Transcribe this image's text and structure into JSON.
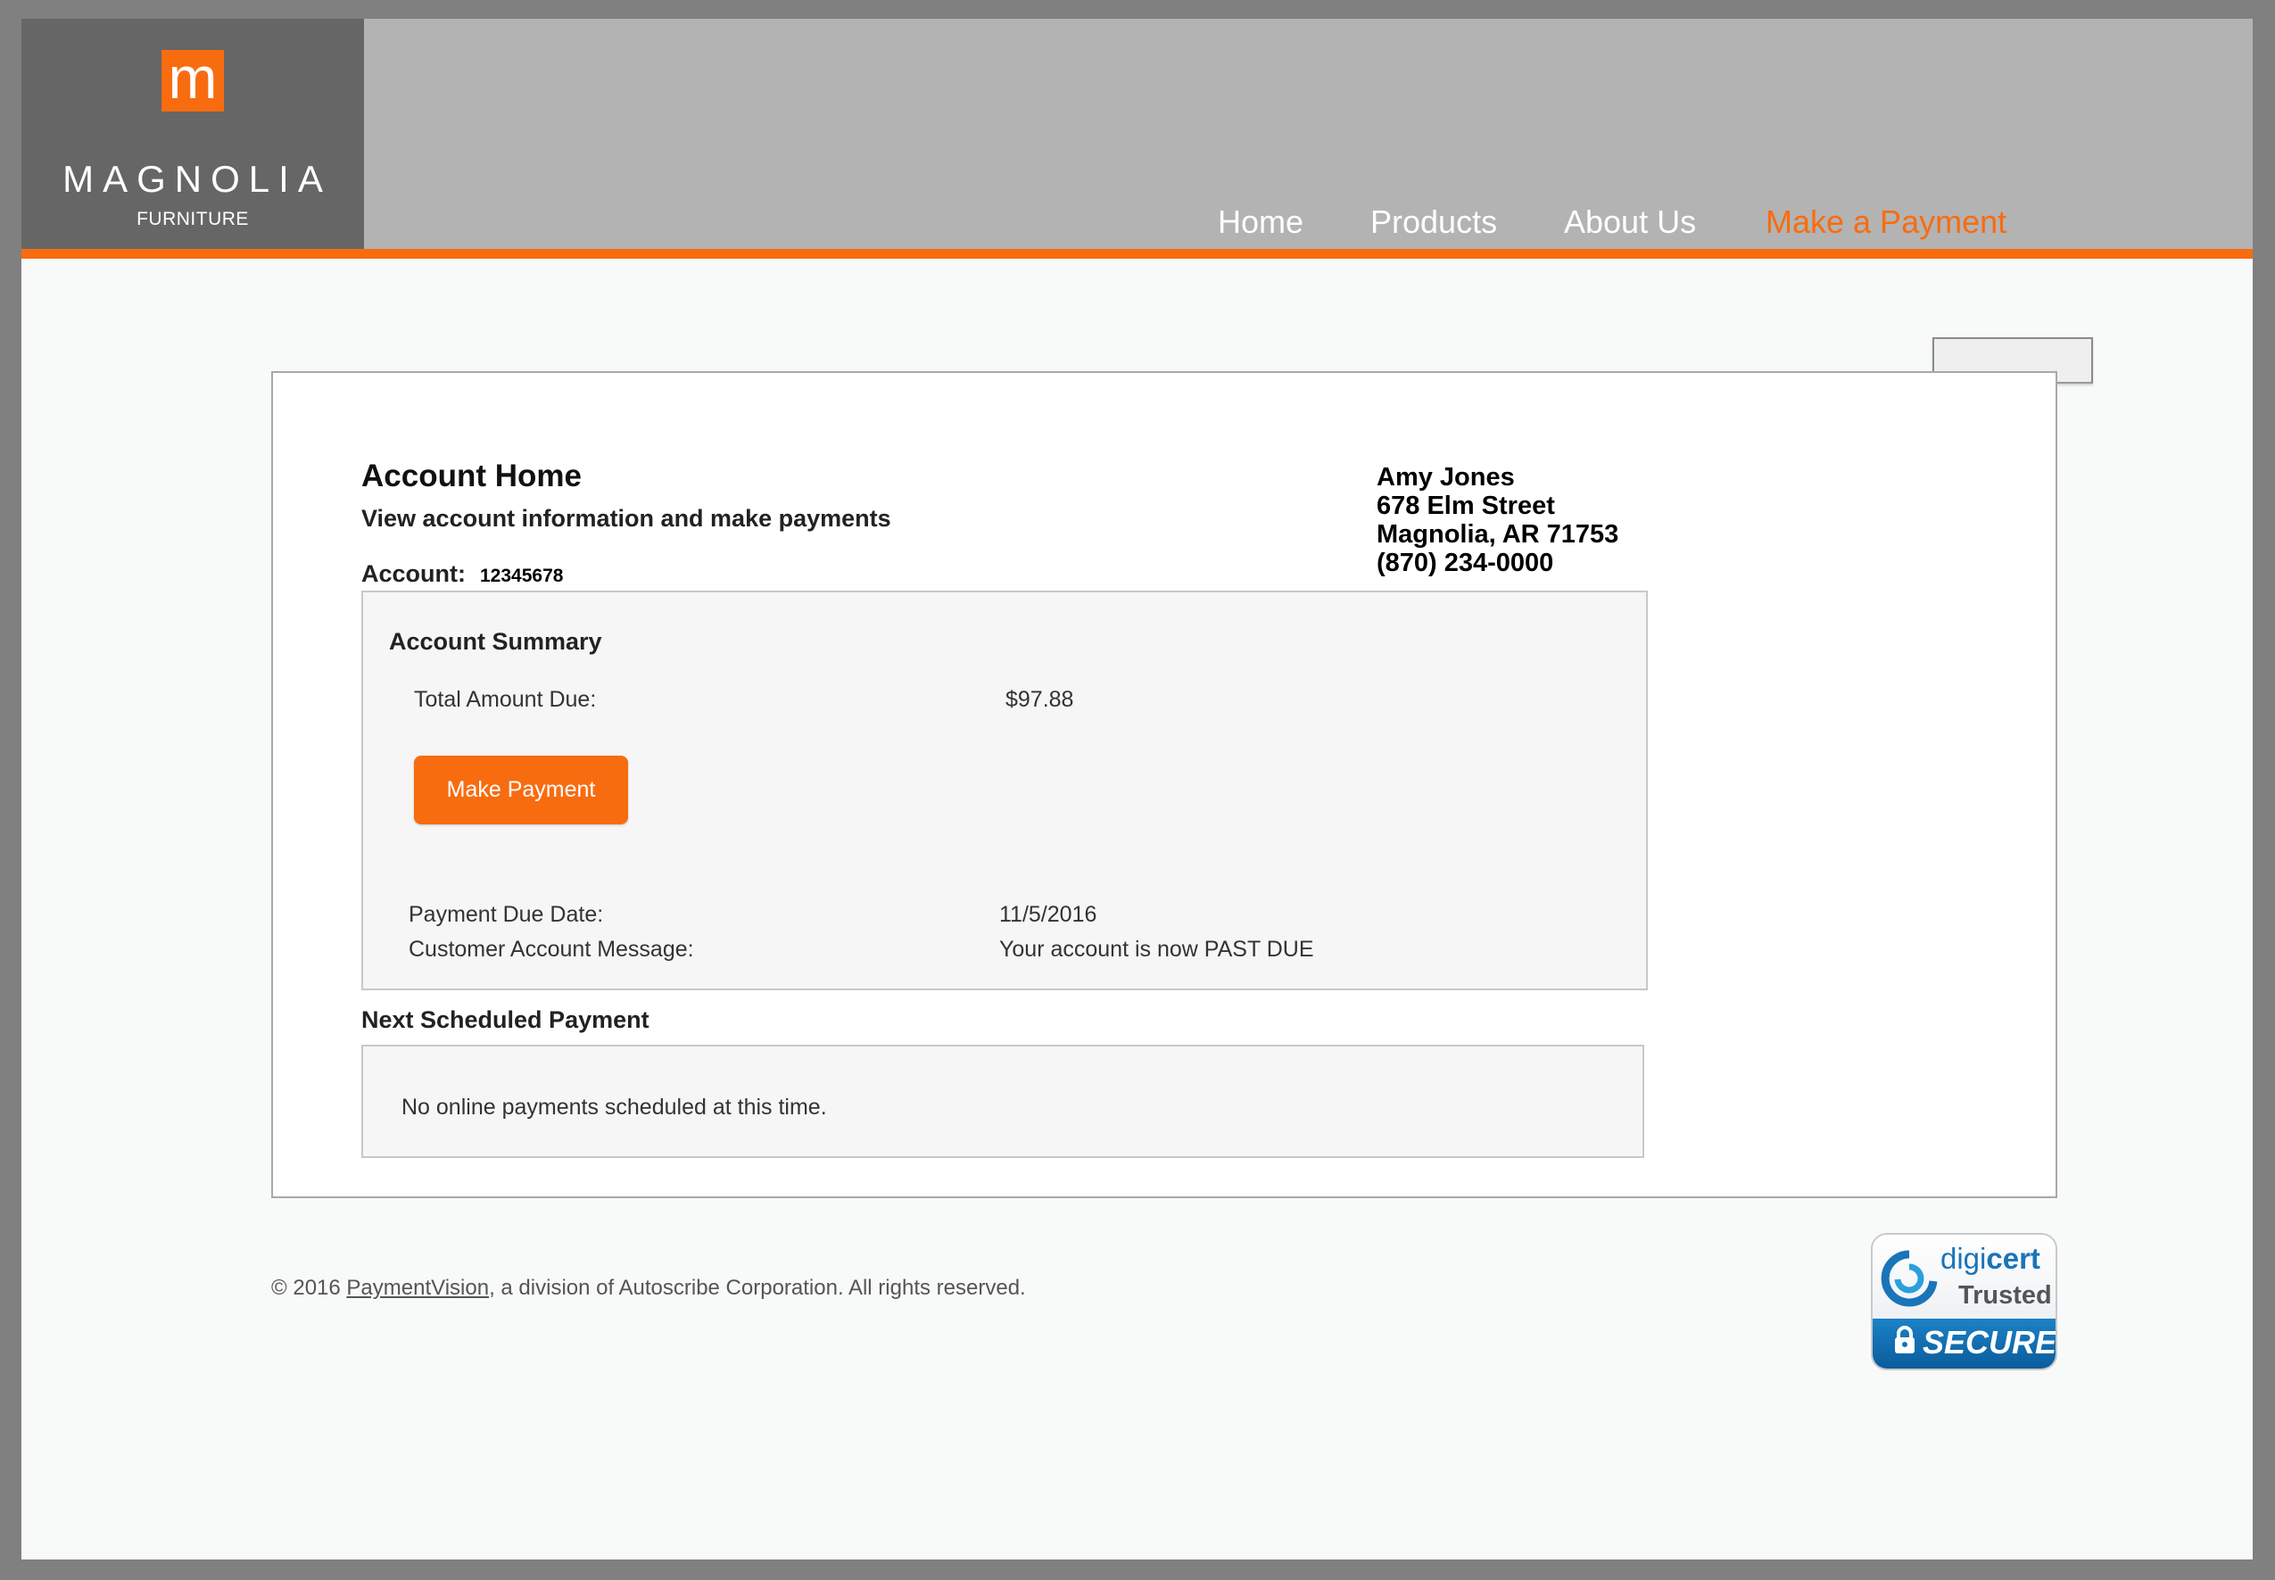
{
  "brand": {
    "logo_letter": "m",
    "name": "MAGNOLIA",
    "sub": "FURNITURE"
  },
  "nav": {
    "items": [
      {
        "label": "Home",
        "active": false
      },
      {
        "label": "Products",
        "active": false
      },
      {
        "label": "About Us",
        "active": false
      },
      {
        "label": "Make a Payment",
        "active": true
      }
    ]
  },
  "colors": {
    "accent": "#f86c10",
    "header_bg": "#b3b3b3",
    "logo_bg": "#666666"
  },
  "account": {
    "title": "Account Home",
    "subtitle": "View account information and make payments",
    "label": "Account:",
    "number": "12345678"
  },
  "customer": {
    "name": "Amy Jones",
    "street": "678 Elm Street",
    "city": "Magnolia, AR 71753",
    "phone": "(870) 234-0000"
  },
  "summary": {
    "title": "Account Summary",
    "total_label": "Total Amount Due:",
    "total_value": "$97.88",
    "button_label": "Make Payment",
    "due_label": "Payment Due Date:",
    "due_value": "11/5/2016",
    "message_label": "Customer Account Message:",
    "message_value": "Your account is now PAST DUE"
  },
  "scheduled": {
    "title": "Next Scheduled Payment",
    "message": "No online payments scheduled at this time."
  },
  "footer": {
    "prefix": "© 2016 ",
    "link": "PaymentVision",
    "suffix": ", a division of Autoscribe Corporation. All rights reserved."
  },
  "seal": {
    "digi": "digi",
    "cert": "cert",
    "trusted": "Trusted",
    "secure": "SECURE",
    "icon": "lock-icon"
  }
}
